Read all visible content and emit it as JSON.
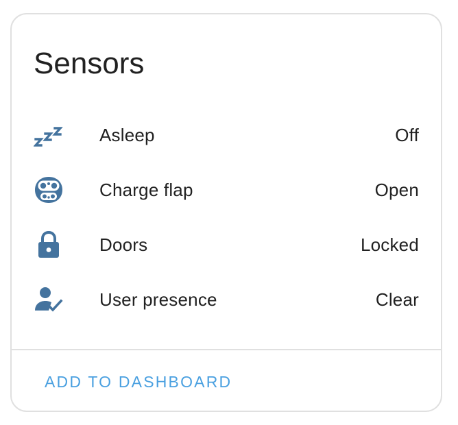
{
  "card": {
    "title": "Sensors",
    "icon_color": "#44739e",
    "accent_color": "#4aa0e0",
    "sensors": [
      {
        "icon": "sleep-icon",
        "label": "Asleep",
        "value": "Off"
      },
      {
        "icon": "ev-plug-icon",
        "label": "Charge flap",
        "value": "Open"
      },
      {
        "icon": "lock-icon",
        "label": "Doors",
        "value": "Locked"
      },
      {
        "icon": "account-check-icon",
        "label": "User presence",
        "value": "Clear"
      }
    ],
    "action_label": "ADD TO DASHBOARD"
  }
}
